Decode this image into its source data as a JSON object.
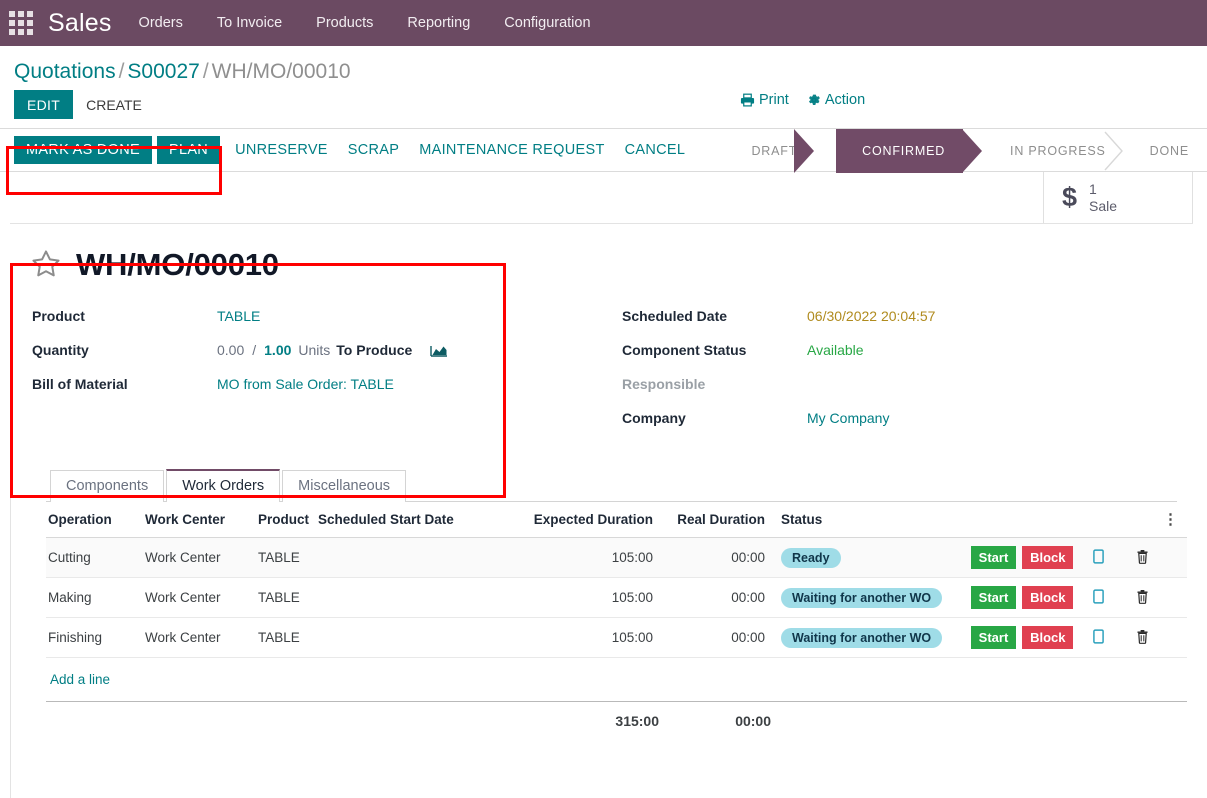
{
  "navbar": {
    "apps_icon": "apps-grid-icon",
    "brand": "Sales",
    "menu": [
      {
        "label": "Orders"
      },
      {
        "label": "To Invoice"
      },
      {
        "label": "Products"
      },
      {
        "label": "Reporting"
      },
      {
        "label": "Configuration"
      }
    ],
    "bg_color": "#6B4A62"
  },
  "breadcrumb": {
    "root": "Quotations",
    "sep": "/",
    "parent": "S00027",
    "current": "WH/MO/00010"
  },
  "control_panel": {
    "edit_label": "EDIT",
    "create_label": "CREATE",
    "print_label": "Print",
    "action_label": "Action",
    "print_icon": "printer-icon",
    "action_icon": "gear-icon"
  },
  "statusbar": {
    "buttons": [
      {
        "label": "MARK AS DONE",
        "style": "primary"
      },
      {
        "label": "PLAN",
        "style": "primary"
      },
      {
        "label": "UNRESERVE",
        "style": "text"
      },
      {
        "label": "SCRAP",
        "style": "text"
      },
      {
        "label": "MAINTENANCE REQUEST",
        "style": "text"
      },
      {
        "label": "CANCEL",
        "style": "text"
      }
    ],
    "stages": [
      {
        "label": "DRAFT",
        "active": false
      },
      {
        "label": "CONFIRMED",
        "active": true
      },
      {
        "label": "IN PROGRESS",
        "active": false
      },
      {
        "label": "DONE",
        "active": false
      }
    ],
    "active_color": "#714B67",
    "primary_color": "#017E84"
  },
  "smart_buttons": [
    {
      "icon": "dollar-icon",
      "count": "1",
      "label": "Sale"
    }
  ],
  "record": {
    "star_icon": "star-icon",
    "title": "WH/MO/00010",
    "left_fields": [
      {
        "label": "Product",
        "value": "TABLE",
        "type": "link"
      },
      {
        "label": "Quantity",
        "type": "quantity"
      },
      {
        "label": "Bill of Material",
        "value": "MO from Sale Order: TABLE",
        "type": "link"
      }
    ],
    "quantity": {
      "done": "0.00",
      "separator": "/",
      "to_produce": "1.00",
      "uom": "Units",
      "suffix": "To Produce",
      "chart_icon": "area-chart-icon"
    },
    "right_fields": [
      {
        "label": "Scheduled Date",
        "value": "06/30/2022 20:04:57",
        "type": "date"
      },
      {
        "label": "Component Status",
        "value": "Available",
        "type": "ok"
      },
      {
        "label": "Responsible",
        "value": "",
        "type": "empty"
      },
      {
        "label": "Company",
        "value": "My Company",
        "type": "link"
      }
    ]
  },
  "notebook": {
    "tabs": [
      {
        "label": "Components",
        "active": false
      },
      {
        "label": "Work Orders",
        "active": true
      },
      {
        "label": "Miscellaneous",
        "active": false
      }
    ]
  },
  "work_orders": {
    "columns": [
      {
        "label": "Operation",
        "align": "left"
      },
      {
        "label": "Work Center",
        "align": "left"
      },
      {
        "label": "Product",
        "align": "left"
      },
      {
        "label": "Scheduled Start Date",
        "align": "left"
      },
      {
        "label": "Expected Duration",
        "align": "right"
      },
      {
        "label": "Real Duration",
        "align": "right"
      },
      {
        "label": "Status",
        "align": "left"
      }
    ],
    "options_icon": "vertical-dots-icon",
    "rows": [
      {
        "operation": "Cutting",
        "work_center": "Work Center",
        "product": "TABLE",
        "scheduled_start_date": "",
        "expected_duration": "105:00",
        "real_duration": "00:00",
        "status": "Ready",
        "start_label": "Start",
        "block_label": "Block",
        "tablet_icon": "tablet-icon",
        "delete_icon": "trash-icon"
      },
      {
        "operation": "Making",
        "work_center": "Work Center",
        "product": "TABLE",
        "scheduled_start_date": "",
        "expected_duration": "105:00",
        "real_duration": "00:00",
        "status": "Waiting for another WO",
        "start_label": "Start",
        "block_label": "Block",
        "tablet_icon": "tablet-icon",
        "delete_icon": "trash-icon"
      },
      {
        "operation": "Finishing",
        "work_center": "Work Center",
        "product": "TABLE",
        "scheduled_start_date": "",
        "expected_duration": "105:00",
        "real_duration": "00:00",
        "status": "Waiting for another WO",
        "start_label": "Start",
        "block_label": "Block",
        "tablet_icon": "tablet-icon",
        "delete_icon": "trash-icon"
      }
    ],
    "add_line_label": "Add a line",
    "totals": {
      "expected_duration": "315:00",
      "real_duration": "00:00"
    },
    "colors": {
      "start_button": "#28A745",
      "block_button": "#E04050",
      "badge_bg": "#9FDCE7"
    }
  },
  "annotations": [
    {
      "name": "highlight-action-buttons"
    },
    {
      "name": "highlight-record-summary"
    }
  ]
}
